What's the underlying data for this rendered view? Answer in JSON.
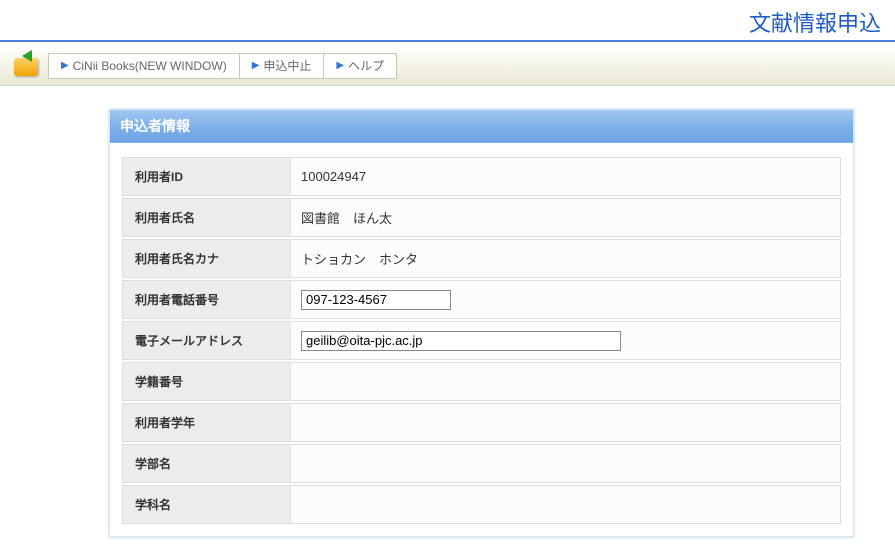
{
  "header": {
    "title": "文献情報申込"
  },
  "toolbar": {
    "items": [
      {
        "label": "CiNii Books(NEW WINDOW)"
      },
      {
        "label": "申込中止"
      },
      {
        "label": "ヘルプ"
      }
    ]
  },
  "card": {
    "title": "申込者情報",
    "rows": {
      "user_id": {
        "label": "利用者ID",
        "value": "100024947"
      },
      "user_name": {
        "label": "利用者氏名",
        "value": "図書館　ほん太"
      },
      "user_kana": {
        "label": "利用者氏名カナ",
        "value": "トショカン　ホンタ"
      },
      "phone": {
        "label": "利用者電話番号",
        "value": "097-123-4567"
      },
      "email": {
        "label": "電子メールアドレス",
        "value": "geilib@oita-pjc.ac.jp"
      },
      "student_no": {
        "label": "学籍番号",
        "value": ""
      },
      "grade": {
        "label": "利用者学年",
        "value": ""
      },
      "faculty": {
        "label": "学部名",
        "value": ""
      },
      "department": {
        "label": "学科名",
        "value": ""
      }
    }
  }
}
